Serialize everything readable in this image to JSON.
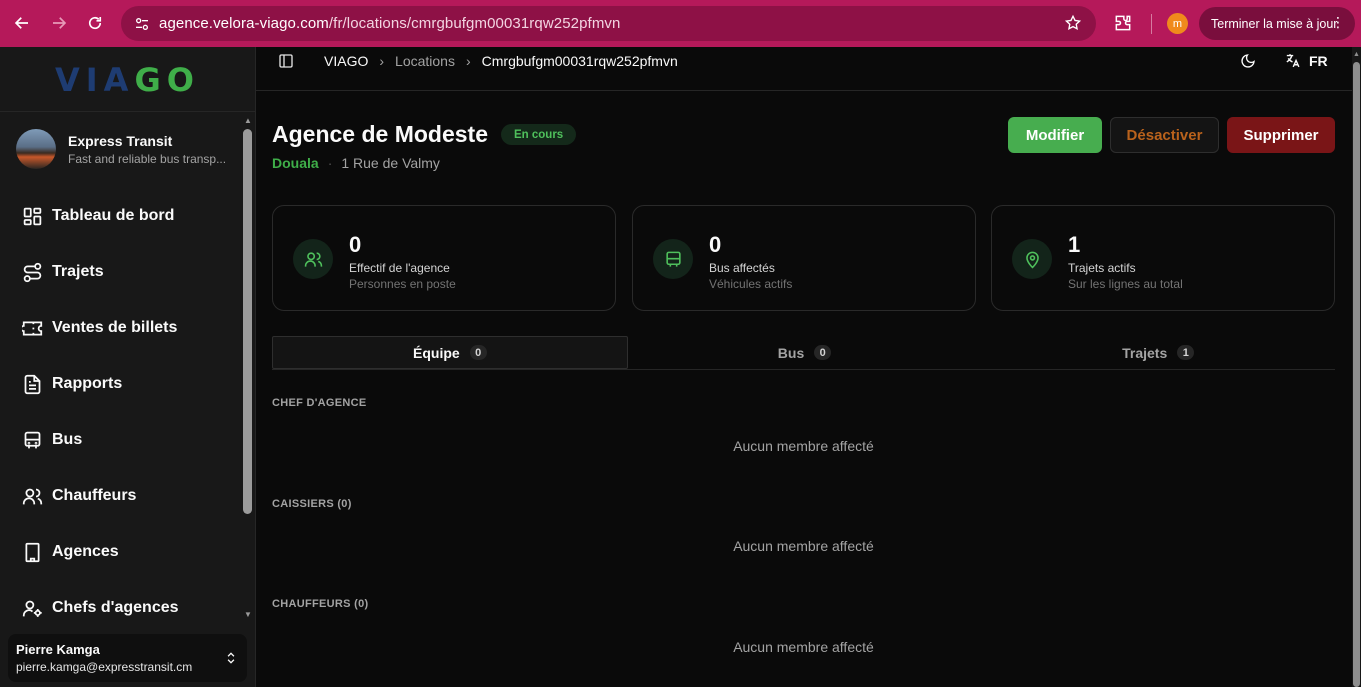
{
  "browser": {
    "url_host": "agence.velora-viago.com",
    "url_path": "/fr/locations/cmrgbufgm00031rqw252pfmvn",
    "profile_initial": "m",
    "update_label": "Terminer la mise à jour"
  },
  "sidebar": {
    "logo_via": "VIA",
    "logo_go": "GO",
    "company": {
      "name": "Express Transit",
      "description": "Fast and reliable bus transp..."
    },
    "items": [
      {
        "label": "Tableau de bord",
        "icon": "dashboard-icon"
      },
      {
        "label": "Trajets",
        "icon": "route-icon"
      },
      {
        "label": "Ventes de billets",
        "icon": "ticket-icon"
      },
      {
        "label": "Rapports",
        "icon": "report-icon"
      },
      {
        "label": "Bus",
        "icon": "bus-icon"
      },
      {
        "label": "Chauffeurs",
        "icon": "drivers-icon"
      },
      {
        "label": "Agences",
        "icon": "building-icon"
      },
      {
        "label": "Chefs d'agences",
        "icon": "manager-icon"
      }
    ],
    "user": {
      "name": "Pierre Kamga",
      "email": "pierre.kamga@expresstransit.cm"
    }
  },
  "topbar": {
    "breadcrumbs": [
      "VIAGO",
      "Locations",
      "Cmrgbufgm00031rqw252pfmvn"
    ],
    "language": "FR"
  },
  "header": {
    "title": "Agence de Modeste",
    "status": "En cours",
    "city": "Douala",
    "separator": "·",
    "address": "1 Rue de Valmy",
    "buttons": {
      "edit": "Modifier",
      "deactivate": "Désactiver",
      "delete": "Supprimer"
    }
  },
  "stats": [
    {
      "value": "0",
      "label": "Effectif de l'agence",
      "sub": "Personnes en poste",
      "icon": "users-icon"
    },
    {
      "value": "0",
      "label": "Bus affectés",
      "sub": "Véhicules actifs",
      "icon": "bus-icon"
    },
    {
      "value": "1",
      "label": "Trajets actifs",
      "sub": "Sur les lignes au total",
      "icon": "map-pin-icon"
    }
  ],
  "tabs": [
    {
      "label": "Équipe",
      "count": "0",
      "active": true
    },
    {
      "label": "Bus",
      "count": "0",
      "active": false
    },
    {
      "label": "Trajets",
      "count": "1",
      "active": false
    }
  ],
  "sections": [
    {
      "heading": "CHEF D'AGENCE",
      "empty": "Aucun membre affecté"
    },
    {
      "heading": "CAISSIERS (0)",
      "empty": "Aucun membre affecté"
    },
    {
      "heading": "CHAUFFEURS (0)",
      "empty": "Aucun membre affecté"
    }
  ],
  "colors": {
    "accent": "#47ad4f",
    "chrome": "#b5195a",
    "danger": "#7a1517",
    "warning_text": "#b9621c"
  }
}
